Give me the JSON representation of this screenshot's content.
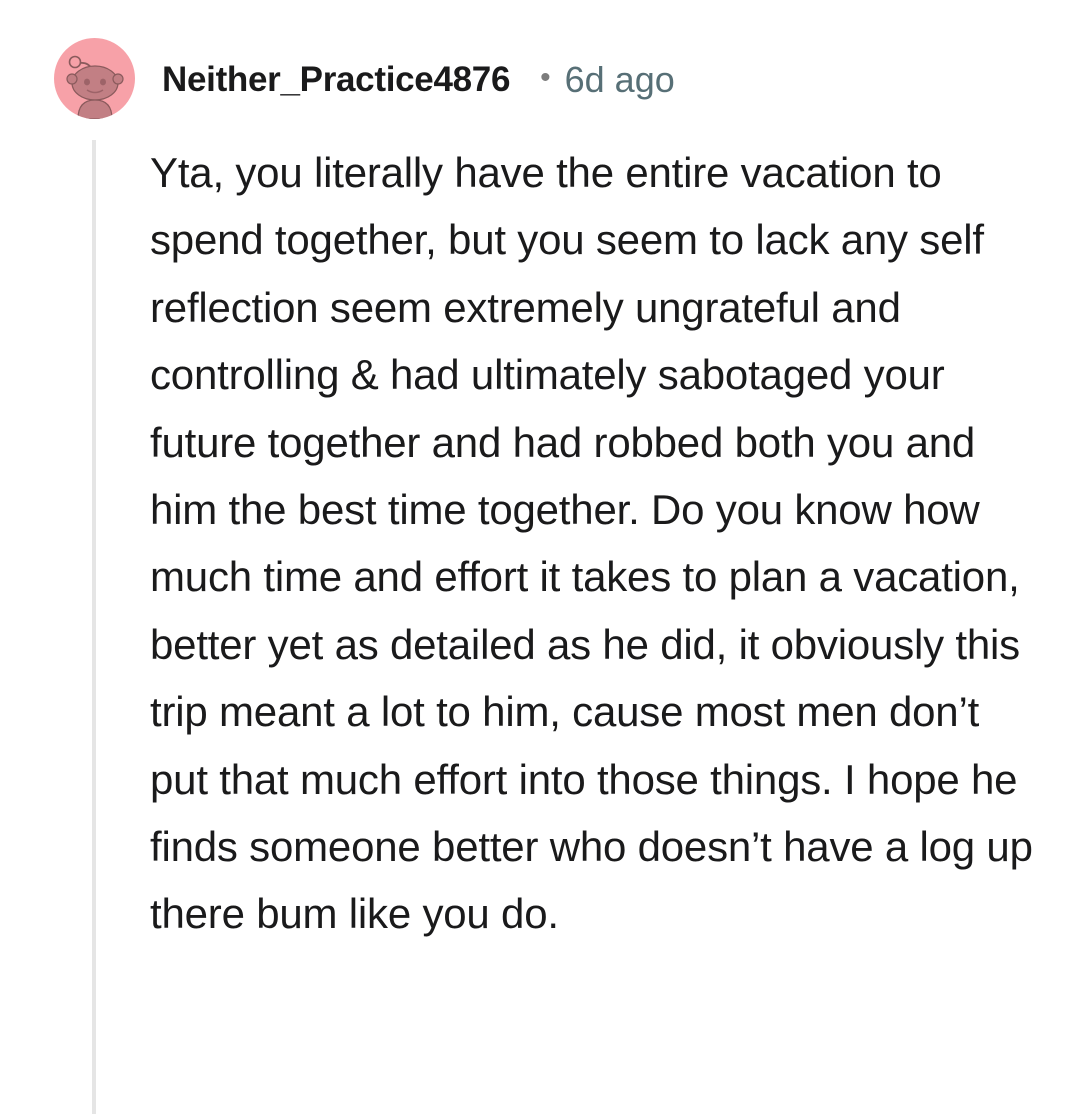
{
  "comment": {
    "author": "Neither_Practice4876",
    "separator": "•",
    "timestamp": "6d ago",
    "avatar": {
      "icon": "snoo-avatar-icon",
      "background_color": "#f7a1a8"
    },
    "body": "Yta, you literally have the entire vacation to spend together, but you seem to lack any self reflection seem extremely ungrateful and controlling & had ultimately sabotaged your future together and had robbed both you and him the best time together. Do you know how much time and effort it takes to plan a vacation, better yet as detailed as he did, it obviously this trip meant a lot to him, cause most men don’t put that much effort into those things. I hope he finds someone better who doesn’t have a log up there bum like you do."
  }
}
